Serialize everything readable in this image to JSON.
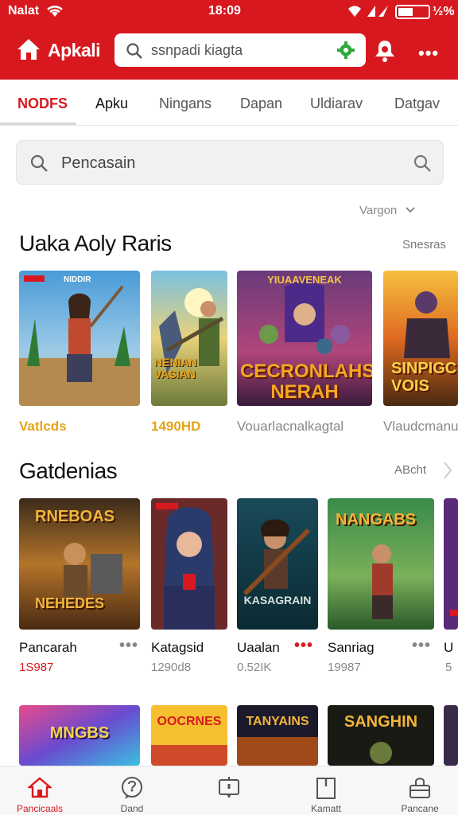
{
  "status_bar": {
    "carrier": "Nalat",
    "time": "18:09",
    "battery": "½%"
  },
  "header": {
    "app_title": "Apkali",
    "search_value": "ssnpadi kiagta"
  },
  "tabs": [
    {
      "label": "NODFS",
      "active": true
    },
    {
      "label": "Apku"
    },
    {
      "label": "Ningans"
    },
    {
      "label": "Dapan"
    },
    {
      "label": "Uldiarav"
    },
    {
      "label": "Datgav"
    }
  ],
  "search2": {
    "placeholder": "Pencasain"
  },
  "version_label": "Vargon",
  "section1": {
    "title": "Uaka Aoly Raris",
    "link": "Snesras",
    "cards": [
      {
        "art_title": "NIDDIR",
        "caption": "Vatlcds"
      },
      {
        "art_title": "NENIAN VASIAN",
        "caption": "1490HD"
      },
      {
        "art_title": "CECRONLAHS NERAH",
        "banner": "YIUAAVENEAK",
        "caption": "Vouarlacnalkagtal"
      },
      {
        "art_title": "SINPIGC VOIS",
        "caption": "Vlaudcmanu"
      }
    ]
  },
  "section2": {
    "title": "Gatdenias",
    "link": "ABcht",
    "cards": [
      {
        "art_title": "RNEBOAS",
        "art_sub": "NEHEDES",
        "name": "Pancarah",
        "meta": "1S987"
      },
      {
        "art_title": "",
        "name": "Katagsid",
        "meta": "1290d8"
      },
      {
        "art_title": "KASAGRAIN",
        "name": "Uaalan",
        "meta": "0.52IK"
      },
      {
        "art_title": "NANGABS",
        "name": "Sanriag",
        "meta": "19987"
      },
      {
        "art_title": "",
        "name": "U",
        "meta": "5"
      }
    ]
  },
  "section3": {
    "cards": [
      {
        "art_title": "MNGBS"
      },
      {
        "art_title": "OOCRNES"
      },
      {
        "art_title": "TANYAINS"
      },
      {
        "art_title": "SANGHIN"
      }
    ]
  },
  "bottom_nav": [
    {
      "label": "Pancicaals",
      "icon": "home-icon",
      "active": true
    },
    {
      "label": "Dand",
      "icon": "chat-bubble-icon"
    },
    {
      "label": "",
      "icon": "message-icon"
    },
    {
      "label": "Kamatt",
      "icon": "bookmark-icon"
    },
    {
      "label": "Pancane",
      "icon": "bag-icon"
    }
  ],
  "colors": {
    "brand_red": "#d7191f",
    "gold": "#e5a418"
  }
}
